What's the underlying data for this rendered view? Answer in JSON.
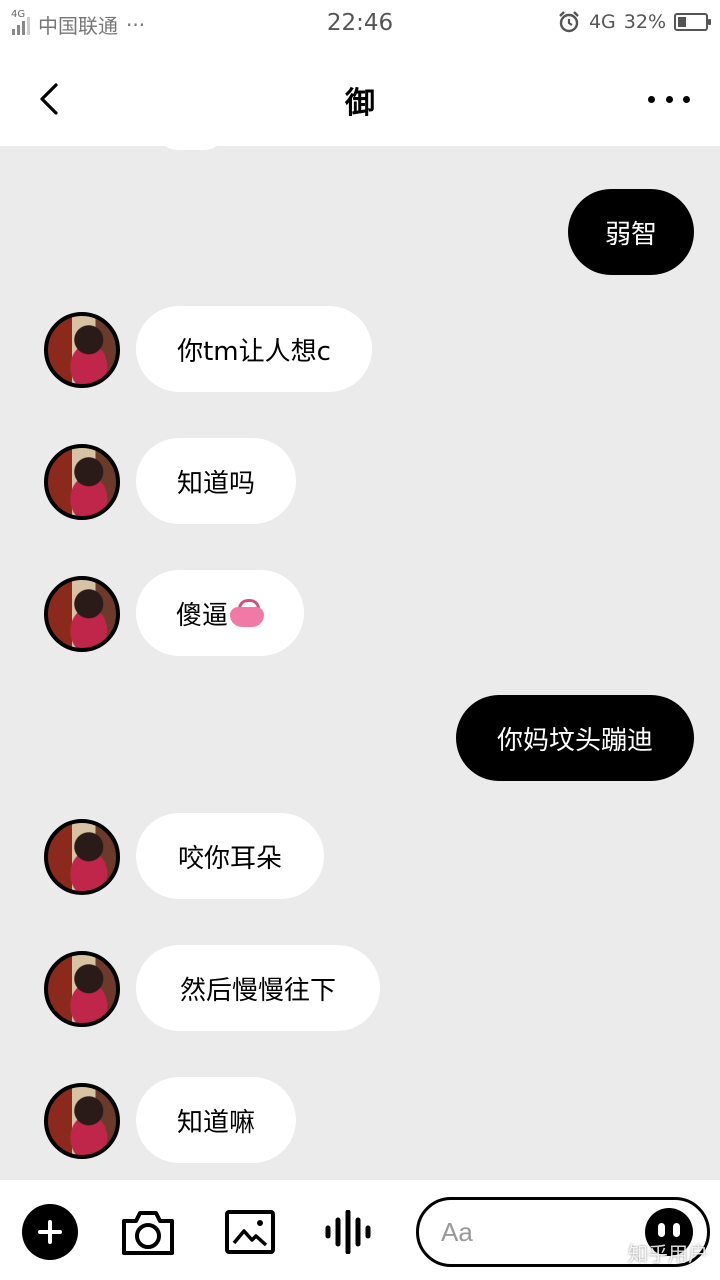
{
  "status_bar": {
    "network_small": "4G",
    "carrier": "中国联通",
    "more_indicator": "···",
    "time": "22:46",
    "network": "4G",
    "battery": "32%",
    "battery_level": 0.32,
    "icons": [
      "signal-icon",
      "alarm-icon",
      "battery-charging-icon"
    ]
  },
  "header": {
    "title": "御",
    "back_icon": "chevron-left-icon",
    "more_icon": "more-dots-icon"
  },
  "messages": [
    {
      "direction": "out",
      "text": "弱智"
    },
    {
      "direction": "in",
      "text": "你tm让人想c"
    },
    {
      "direction": "in",
      "text": "知道吗"
    },
    {
      "direction": "in",
      "text": "傻逼",
      "emoji": "purse-emoji"
    },
    {
      "direction": "out",
      "text": "你妈坟头蹦迪"
    },
    {
      "direction": "in",
      "text": "咬你耳朵"
    },
    {
      "direction": "in",
      "text": "然后慢慢往下"
    },
    {
      "direction": "in",
      "text": "知道嘛"
    }
  ],
  "toolbar": {
    "icons": [
      "plus-icon",
      "camera-icon",
      "image-icon",
      "voice-icon",
      "emoji-icon"
    ],
    "input_placeholder": "Aa",
    "input_value": ""
  },
  "watermark": "知乎用户"
}
